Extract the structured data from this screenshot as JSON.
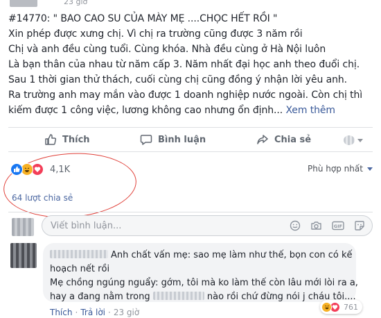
{
  "post": {
    "time": "23 giờ",
    "lines": [
      "#14770: \" BAO CAO SU CỦA MÀY MẸ ....CHỌC HẾT RỒI \"",
      "Xin phép được xưng chị. Vì chị ra trường cũng được 3 năm rồi",
      "Chị và anh đều cùng tuổi. Cùng khóa. Nhà đều cùng ở Hà Nội luôn",
      "Là bạn thân của nhau từ năm cấp 3. Năm nhất đại học anh theo đuổi chị.",
      "Sau 1 thời gian thử thách, cuối cùng chị cũng đồng ý nhận lời yêu anh.",
      "Ra trường anh may mắn vào được 1 doanh nghiệp nước ngoài. Còn chị thì",
      "kiếm được 1 công việc, lương không cao nhưng ổn định..."
    ],
    "see_more": "Xem thêm"
  },
  "actions": {
    "like": "Thích",
    "comment": "Bình luận",
    "share": "Chia sẻ"
  },
  "stats": {
    "reaction_count": "4,1K",
    "sort_label": "Phù hợp nhất",
    "shares": "64 lượt chia sẻ"
  },
  "composer": {
    "placeholder": "Viết bình luận..."
  },
  "reply": {
    "line1": "Anh chất vấn mẹ: sao mẹ làm như thế, bọn con có kế",
    "line2": "hoạch nết rồi",
    "line3": "Mẹ chồng ngúng nguẩy: gớm, tôi mà ko làm thế còn lâu mới lòi ra a,",
    "line4a": "hay a đang nằm trong",
    "line4b": "nào rồi chứ đừng nói j cháu tôi....",
    "reaction_count": "761",
    "like": "Thích",
    "reply": "Trả lời",
    "time": "23 giờ"
  },
  "colors": {
    "link": "#385898",
    "annotation": "#e0413a",
    "like_blue": "#1877f2",
    "haha_yellow": "#f7b125",
    "love_red": "#f33e58"
  }
}
